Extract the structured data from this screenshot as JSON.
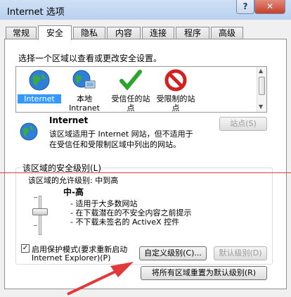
{
  "window": {
    "title": "Internet 选项",
    "help_label": "?",
    "close_label": "✕"
  },
  "tabs": [
    "常规",
    "安全",
    "隐私",
    "内容",
    "连接",
    "程序",
    "高级"
  ],
  "security": {
    "instruction": "选择一个区域以查看或更改安全设置。",
    "zones": [
      {
        "label": "Internet",
        "icon": "globe-icon"
      },
      {
        "label": "本地 Intranet",
        "icon": "intranet-icon"
      },
      {
        "label": "受信任的站点",
        "icon": "check-icon"
      },
      {
        "label": "受限制的站点",
        "icon": "restricted-icon"
      }
    ],
    "zone_title": "Internet",
    "zone_desc_line1": "该区域适用于 Internet 网站，但不适用于",
    "zone_desc_line2": "在受信任和受限制区域中列出的网站。",
    "sites_button": "站点(S)"
  },
  "level_group": {
    "title": "该区域的安全级别(L)",
    "allowed": "该区域的允许级别: 中到高",
    "level_name": "中-高",
    "bullets": [
      "- 适用于大多数网站",
      "- 在下载潜在的不安全内容之前提示",
      "- 不下载未签名的 ActiveX 控件"
    ],
    "protected_mode_line1": "启用保护模式(要求重新启动",
    "protected_mode_line2": "Internet Explorer)(P)",
    "protected_mode_checked": true,
    "custom_button": "自定义级别(C)...",
    "default_button": "默认级别(D)"
  },
  "reset_all_button": "将所有区域重置为默认级别(R)",
  "colors": {
    "annotation": "#e03a3a",
    "selection": "#3399ff"
  }
}
